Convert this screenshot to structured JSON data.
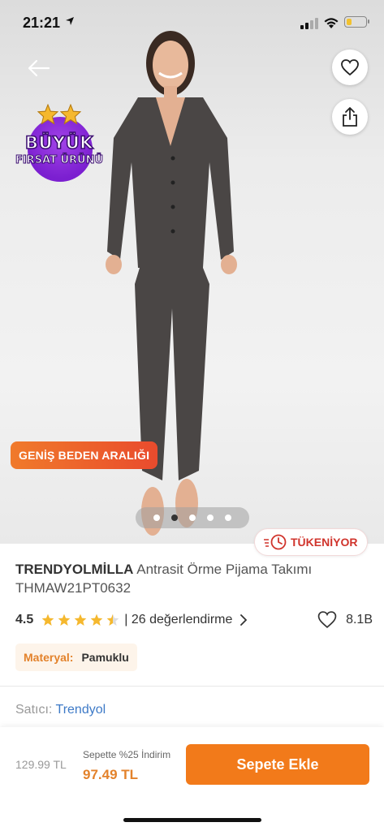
{
  "status_bar": {
    "time": "21:21",
    "battery_level": 0.25,
    "battery_color": "#f2c230"
  },
  "gallery": {
    "badge": {
      "line1": "BÜYÜK",
      "line2": "FIRSAT ÜRÜNÜ",
      "color": "#7b1fd0"
    },
    "size_range_label": "GENİŞ BEDEN ARALIĞI",
    "image_count": 5,
    "active_index": 1
  },
  "soldout_label": "TÜKENİYOR",
  "product": {
    "brand": "TRENDYOLMİLLA",
    "name": "Antrasit Örme Pijama Takımı",
    "code": "THMAW21PT0632",
    "rating": "4.5",
    "rating_value": 4.5,
    "reviews": "| 26 değerlendirme",
    "likes": "8.1B",
    "material_key": "Materyal:",
    "material_value": "Pamuklu"
  },
  "seller": {
    "label": "Satıcı:",
    "name": "Trendyol"
  },
  "cart": {
    "old_price": "129.99 TL",
    "promo": "Sepette %25 İndirim",
    "new_price": "97.49 TL",
    "add_button": "Sepete Ekle"
  },
  "colors": {
    "accent": "#f27a1a",
    "price": "#e3822b",
    "soldout": "#d0342c",
    "link": "#3e7ac7"
  },
  "icons": [
    "back-arrow-icon",
    "heart-icon",
    "share-icon",
    "clock-icon",
    "star-icon",
    "chevron-right-icon"
  ]
}
